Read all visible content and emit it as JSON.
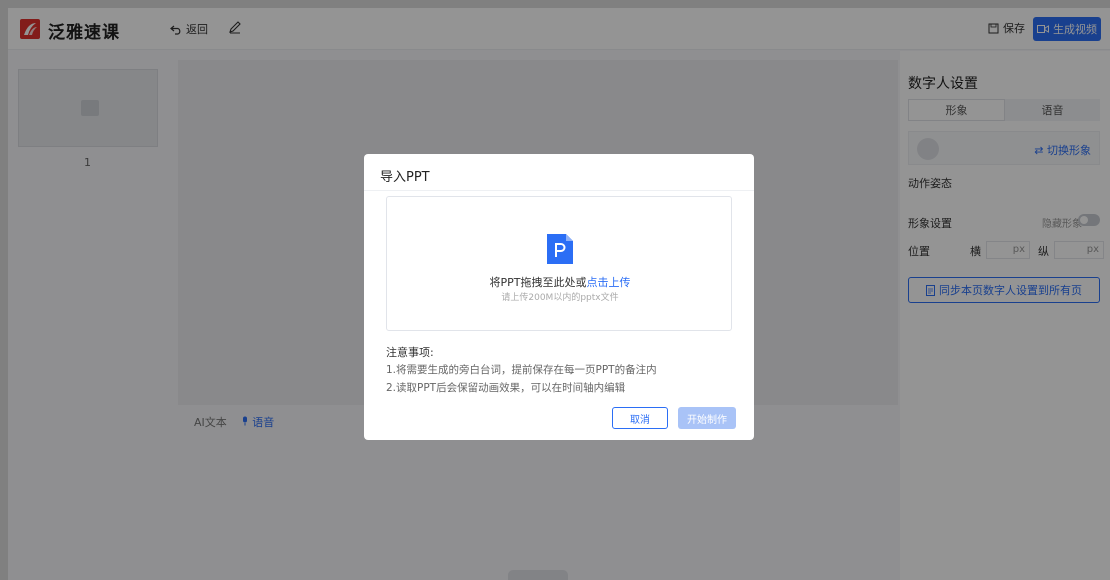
{
  "header": {
    "brand": "泛雅速课",
    "back_label": "返回",
    "save_label": "保存",
    "generate_label": "生成视频"
  },
  "slides": {
    "items": [
      {
        "number": "1"
      }
    ]
  },
  "canvas": {
    "text_tool": "AI文本",
    "audio_tool": "语音"
  },
  "right_panel": {
    "title": "数字人设置",
    "tabs": [
      "形象",
      "语音"
    ],
    "switch_label": "⇄ 切换形象",
    "motion_label": "动作姿态",
    "image_settings_label": "形象设置",
    "hide_label": "隐藏形象",
    "position_label": "位置",
    "horizontal_label": "横",
    "vertical_label": "纵",
    "unit": "px",
    "sync_label": "同步本页数字人设置到所有页"
  },
  "modal": {
    "title": "导入PPT",
    "drop_text": "将PPT拖拽至此处或",
    "upload_link": "点击上传",
    "drop_hint": "请上传200M以内的pptx文件",
    "notes_title": "注意事项:",
    "notes": [
      "1.将需要生成的旁白台词，提前保存在每一页PPT的备注内",
      "2.读取PPT后会保留动画效果，可以在时间轴内编辑"
    ],
    "cancel_label": "取消",
    "start_label": "开始制作"
  },
  "colors": {
    "accent": "#2b6ef5",
    "brand_red": "#e0312d",
    "disabled_button": "#a9c3f7"
  },
  "icons": {
    "logo": "brand-logo-icon",
    "back": "undo-icon",
    "edit": "pencil-icon",
    "save": "save-icon",
    "generate": "video-camera-icon",
    "ppt": "ppt-file-icon",
    "image": "image-placeholder-icon",
    "mic": "microphone-icon",
    "sync": "document-icon"
  }
}
